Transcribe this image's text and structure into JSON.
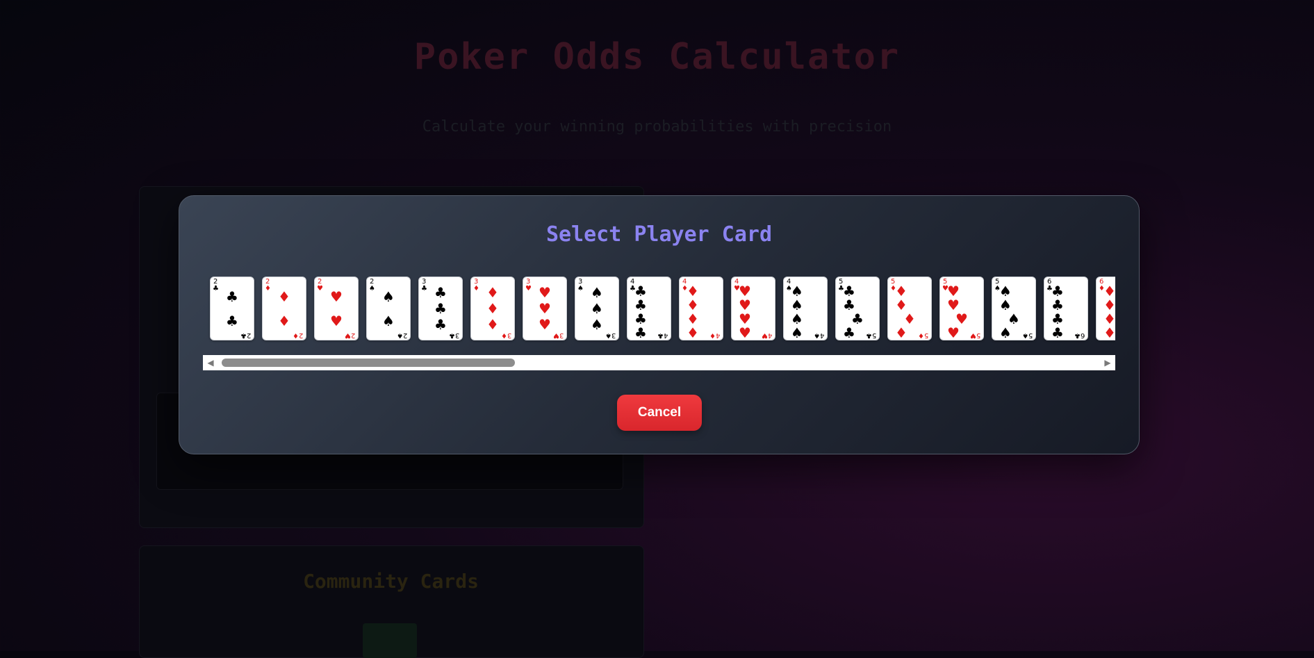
{
  "background": {
    "title": "Poker Odds Calculator",
    "subtitle": "Calculate your winning probabilities with precision",
    "community_title": "Community Cards"
  },
  "modal": {
    "title": "Select Player Card",
    "cancel_label": "Cancel"
  },
  "colors": {
    "title_accent": "#8b83f0",
    "cancel_button": "#e53237",
    "red_suit": "#e01919",
    "black_suit": "#000000"
  },
  "cards": [
    {
      "rank": "2",
      "suit": "♣",
      "color": "black",
      "name": "2-of-clubs"
    },
    {
      "rank": "2",
      "suit": "♦",
      "color": "red",
      "name": "2-of-diamonds"
    },
    {
      "rank": "2",
      "suit": "♥",
      "color": "red",
      "name": "2-of-hearts"
    },
    {
      "rank": "2",
      "suit": "♠",
      "color": "black",
      "name": "2-of-spades"
    },
    {
      "rank": "3",
      "suit": "♣",
      "color": "black",
      "name": "3-of-clubs"
    },
    {
      "rank": "3",
      "suit": "♦",
      "color": "red",
      "name": "3-of-diamonds"
    },
    {
      "rank": "3",
      "suit": "♥",
      "color": "red",
      "name": "3-of-hearts"
    },
    {
      "rank": "3",
      "suit": "♠",
      "color": "black",
      "name": "3-of-spades"
    },
    {
      "rank": "4",
      "suit": "♣",
      "color": "black",
      "name": "4-of-clubs"
    },
    {
      "rank": "4",
      "suit": "♦",
      "color": "red",
      "name": "4-of-diamonds"
    },
    {
      "rank": "4",
      "suit": "♥",
      "color": "red",
      "name": "4-of-hearts"
    },
    {
      "rank": "4",
      "suit": "♠",
      "color": "black",
      "name": "4-of-spades"
    },
    {
      "rank": "5",
      "suit": "♣",
      "color": "black",
      "name": "5-of-clubs"
    },
    {
      "rank": "5",
      "suit": "♦",
      "color": "red",
      "name": "5-of-diamonds"
    },
    {
      "rank": "5",
      "suit": "♥",
      "color": "red",
      "name": "5-of-hearts"
    },
    {
      "rank": "5",
      "suit": "♠",
      "color": "black",
      "name": "5-of-spades"
    },
    {
      "rank": "6",
      "suit": "♣",
      "color": "black",
      "name": "6-of-clubs"
    },
    {
      "rank": "6",
      "suit": "♦",
      "color": "red",
      "name": "6-of-diamonds"
    }
  ],
  "scrollbar": {
    "left_arrow_icon": "triangle-left-icon",
    "right_arrow_icon": "triangle-right-icon",
    "position_fraction": 0.0
  }
}
